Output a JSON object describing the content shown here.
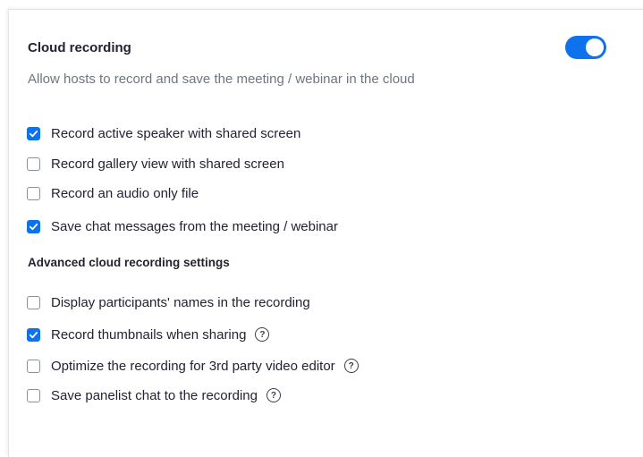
{
  "section": {
    "title": "Cloud recording",
    "description": "Allow hosts to record and save the meeting / webinar in the cloud",
    "toggle_enabled": true,
    "accent_color": "#0e72ed"
  },
  "options": [
    {
      "label": "Record active speaker with shared screen",
      "checked": true
    },
    {
      "label": "Record gallery view with shared screen",
      "checked": false
    },
    {
      "label": "Record an audio only file",
      "checked": false
    },
    {
      "label": "Save chat messages from the meeting / webinar",
      "checked": true
    }
  ],
  "advanced": {
    "heading": "Advanced cloud recording settings",
    "help_glyph": "?",
    "options": [
      {
        "label": "Display participants' names in the recording",
        "checked": false,
        "help": false
      },
      {
        "label": "Record thumbnails when sharing",
        "checked": true,
        "help": true
      },
      {
        "label": "Optimize the recording for 3rd party video editor",
        "checked": false,
        "help": true
      },
      {
        "label": "Save panelist chat to the recording",
        "checked": false,
        "help": true
      }
    ]
  }
}
